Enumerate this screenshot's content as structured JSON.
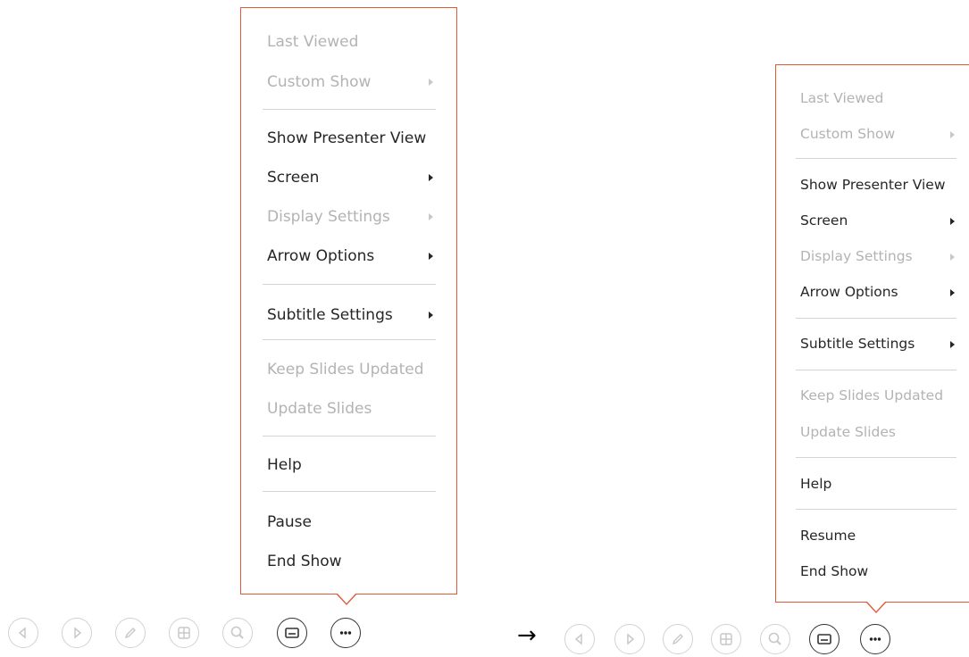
{
  "before_menu": {
    "items": [
      {
        "label": "Last Viewed",
        "disabled": true,
        "submenu": false
      },
      {
        "label": "Custom Show",
        "disabled": true,
        "submenu": true
      },
      {
        "label": "Show Presenter View",
        "disabled": false,
        "submenu": false
      },
      {
        "label": "Screen",
        "disabled": false,
        "submenu": true
      },
      {
        "label": "Display Settings",
        "disabled": true,
        "submenu": true
      },
      {
        "label": "Arrow Options",
        "disabled": false,
        "submenu": true
      },
      {
        "label": "Subtitle Settings",
        "disabled": false,
        "submenu": true
      },
      {
        "label": "Keep Slides Updated",
        "disabled": true,
        "submenu": false
      },
      {
        "label": "Update Slides",
        "disabled": true,
        "submenu": false
      },
      {
        "label": "Help",
        "disabled": false,
        "submenu": false
      },
      {
        "label": "Pause",
        "disabled": false,
        "submenu": false
      },
      {
        "label": "End Show",
        "disabled": false,
        "submenu": false
      }
    ]
  },
  "after_menu": {
    "items": [
      {
        "label": "Last Viewed",
        "disabled": true,
        "submenu": false
      },
      {
        "label": "Custom Show",
        "disabled": true,
        "submenu": true
      },
      {
        "label": "Show Presenter View",
        "disabled": false,
        "submenu": false
      },
      {
        "label": "Screen",
        "disabled": false,
        "submenu": true
      },
      {
        "label": "Display Settings",
        "disabled": true,
        "submenu": true
      },
      {
        "label": "Arrow Options",
        "disabled": false,
        "submenu": true
      },
      {
        "label": "Subtitle Settings",
        "disabled": false,
        "submenu": true
      },
      {
        "label": "Keep Slides Updated",
        "disabled": true,
        "submenu": false
      },
      {
        "label": "Update Slides",
        "disabled": true,
        "submenu": false
      },
      {
        "label": "Help",
        "disabled": false,
        "submenu": false
      },
      {
        "label": "Resume",
        "disabled": false,
        "submenu": false
      },
      {
        "label": "End Show",
        "disabled": false,
        "submenu": false
      }
    ]
  },
  "controls": [
    {
      "icon": "previous-icon",
      "active": false
    },
    {
      "icon": "next-icon",
      "active": false
    },
    {
      "icon": "pen-icon",
      "active": false
    },
    {
      "icon": "see-all-slides-icon",
      "active": false
    },
    {
      "icon": "zoom-icon",
      "active": false
    },
    {
      "icon": "subtitles-icon",
      "active": true
    },
    {
      "icon": "more-options-icon",
      "active": true
    }
  ],
  "transition_symbol": "→",
  "colors": {
    "menu_border": "#e05a3a",
    "enabled_text": "#262626",
    "disabled_text": "#b3b3b3"
  }
}
